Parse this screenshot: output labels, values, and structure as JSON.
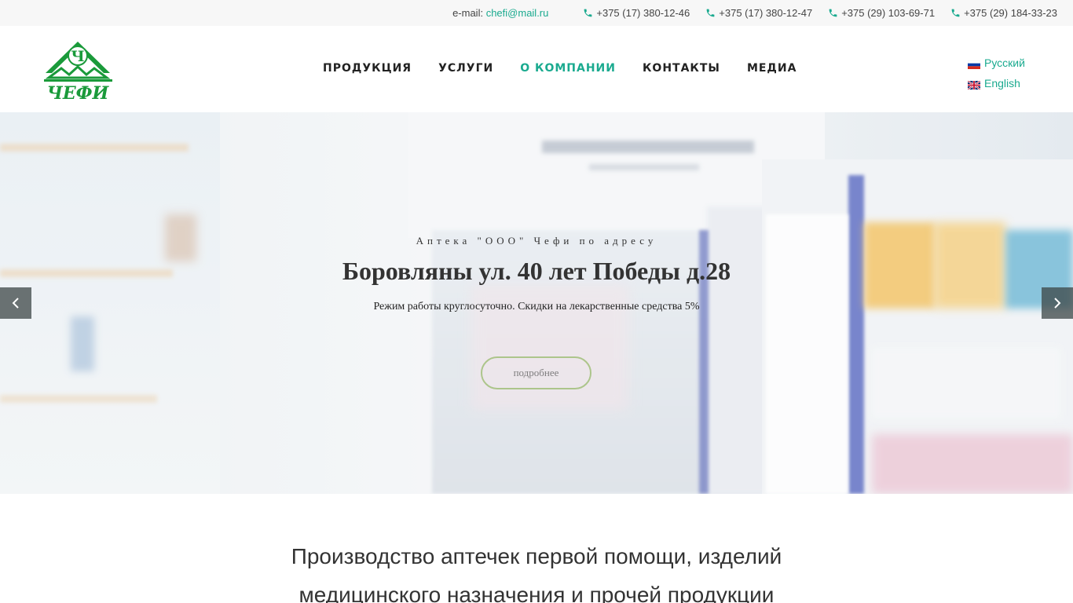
{
  "topbar": {
    "email_label": "e-mail:",
    "email_value": "chefi@mail.ru",
    "phones": [
      "+375 (17) 380-12-46",
      "+375 (17) 380-12-47",
      "+375 (29) 103-69-71",
      "+375 (29) 184-33-23"
    ]
  },
  "logo": {
    "letter": "Ч",
    "text": "ЧЕФИ",
    "color": "#1a9a3a"
  },
  "nav": {
    "items": [
      {
        "label": "ПРОДУКЦИЯ"
      },
      {
        "label": "УСЛУГИ"
      },
      {
        "label": "О КОМПАНИИ",
        "active": true
      },
      {
        "label": "КОНТАКТЫ"
      },
      {
        "label": "МЕДИА"
      }
    ]
  },
  "lang": {
    "russian": "Русский",
    "english": "English"
  },
  "hero": {
    "kicker": "Аптека \"ООО\" Чефи по адресу",
    "title": "Боровляны ул. 40 лет Победы д.28",
    "subtitle": "Режим работы круглосуточно. Скидки на лекарственные средства 5%",
    "button": "подробнее"
  },
  "intro": {
    "line1": "Производство аптечек первой помощи,  изделий",
    "line2": "медицинского назначения и прочей продукции"
  },
  "colors": {
    "accent": "#1aaa8f",
    "logo_green": "#1a9a3a"
  }
}
